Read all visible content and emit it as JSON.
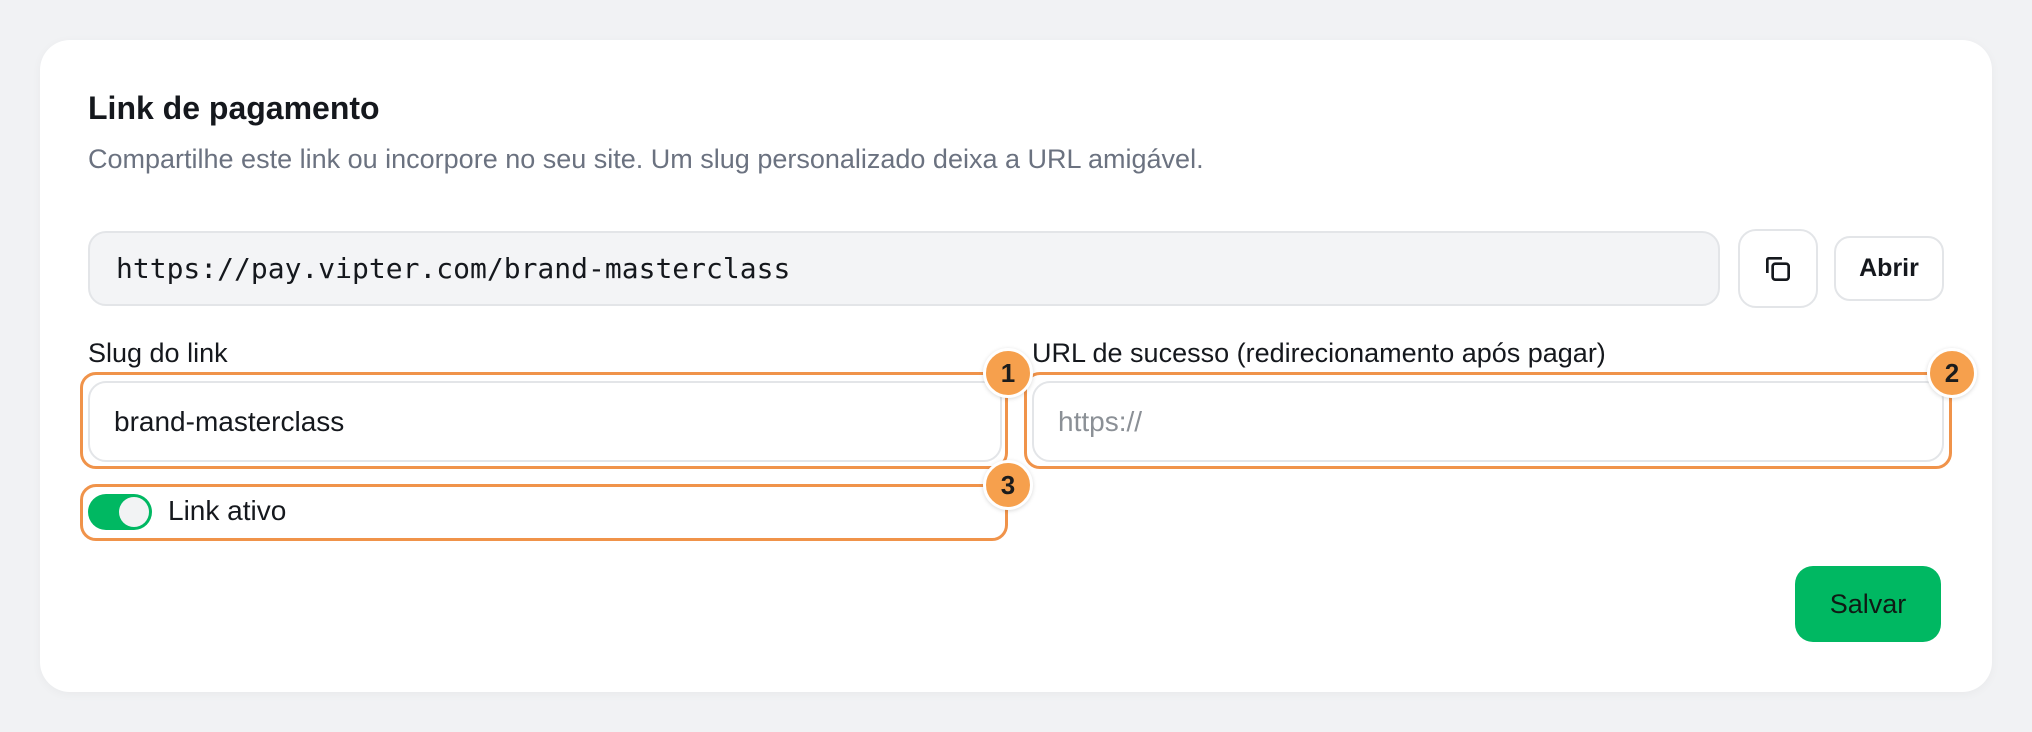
{
  "card": {
    "title": "Link de pagamento",
    "subtitle": "Compartilhe este link ou incorpore no seu site. Um slug personalizado deixa a URL amigável.",
    "payment_url": "https://pay.vipter.com/brand-masterclass",
    "copy_icon": "copy-icon",
    "open_label": "Abrir"
  },
  "fields": {
    "slug_label": "Slug do link",
    "slug_value": "brand-masterclass",
    "success_label": "URL de sucesso (redirecionamento após pagar)",
    "success_placeholder": "https://"
  },
  "toggle": {
    "label": "Link ativo",
    "checked": true,
    "color": "#00b862"
  },
  "actions": {
    "save_label": "Salvar"
  },
  "annotations": {
    "color": "#f0934a",
    "badges": [
      "1",
      "2",
      "3"
    ]
  }
}
